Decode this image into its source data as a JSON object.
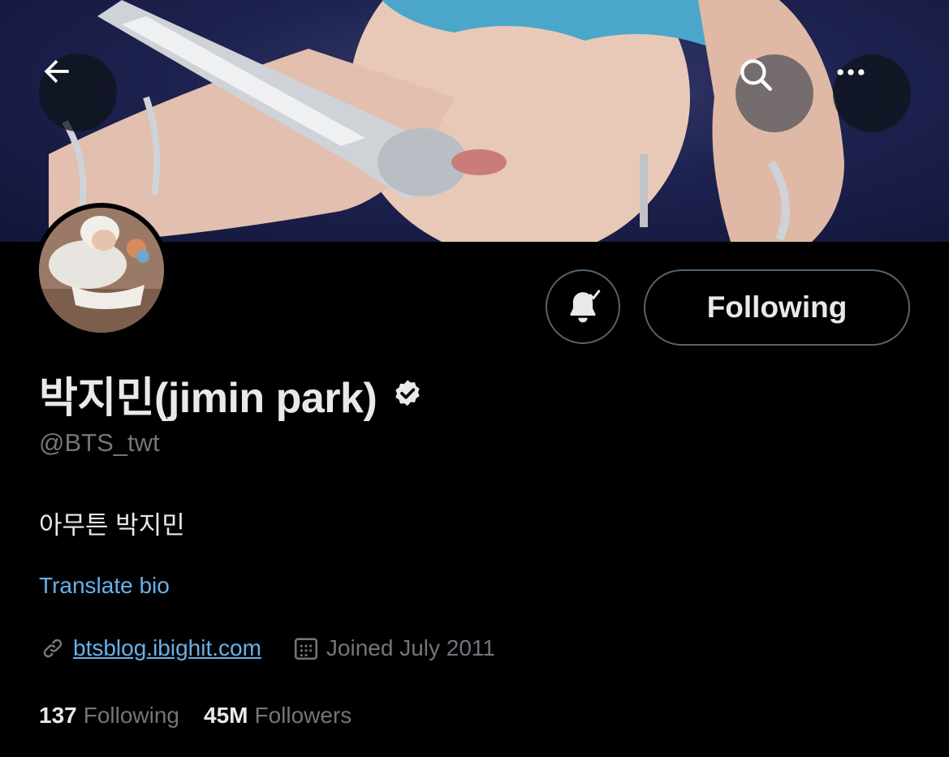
{
  "header": {
    "back_icon": "arrow-left-icon",
    "search_icon": "search-icon",
    "more_icon": "more-horizontal-icon"
  },
  "profile": {
    "display_name": "박지민(jimin park)",
    "verified_icon": "verified-badge-icon",
    "handle": "@BTS_twt",
    "bio": "아무튼 박지민",
    "translate_label": "Translate bio",
    "website": "btsblog.ibighit.com",
    "joined": "Joined July 2011",
    "following_count": "137",
    "following_label": "Following",
    "followers_count": "45M",
    "followers_label": "Followers"
  },
  "actions": {
    "notify_icon": "bell-check-icon",
    "following_button_label": "Following"
  },
  "colors": {
    "background": "#000000",
    "primary_text": "#e7e9ea",
    "secondary_text": "#71767b",
    "link": "#6ab0e8",
    "border": "#536471"
  }
}
